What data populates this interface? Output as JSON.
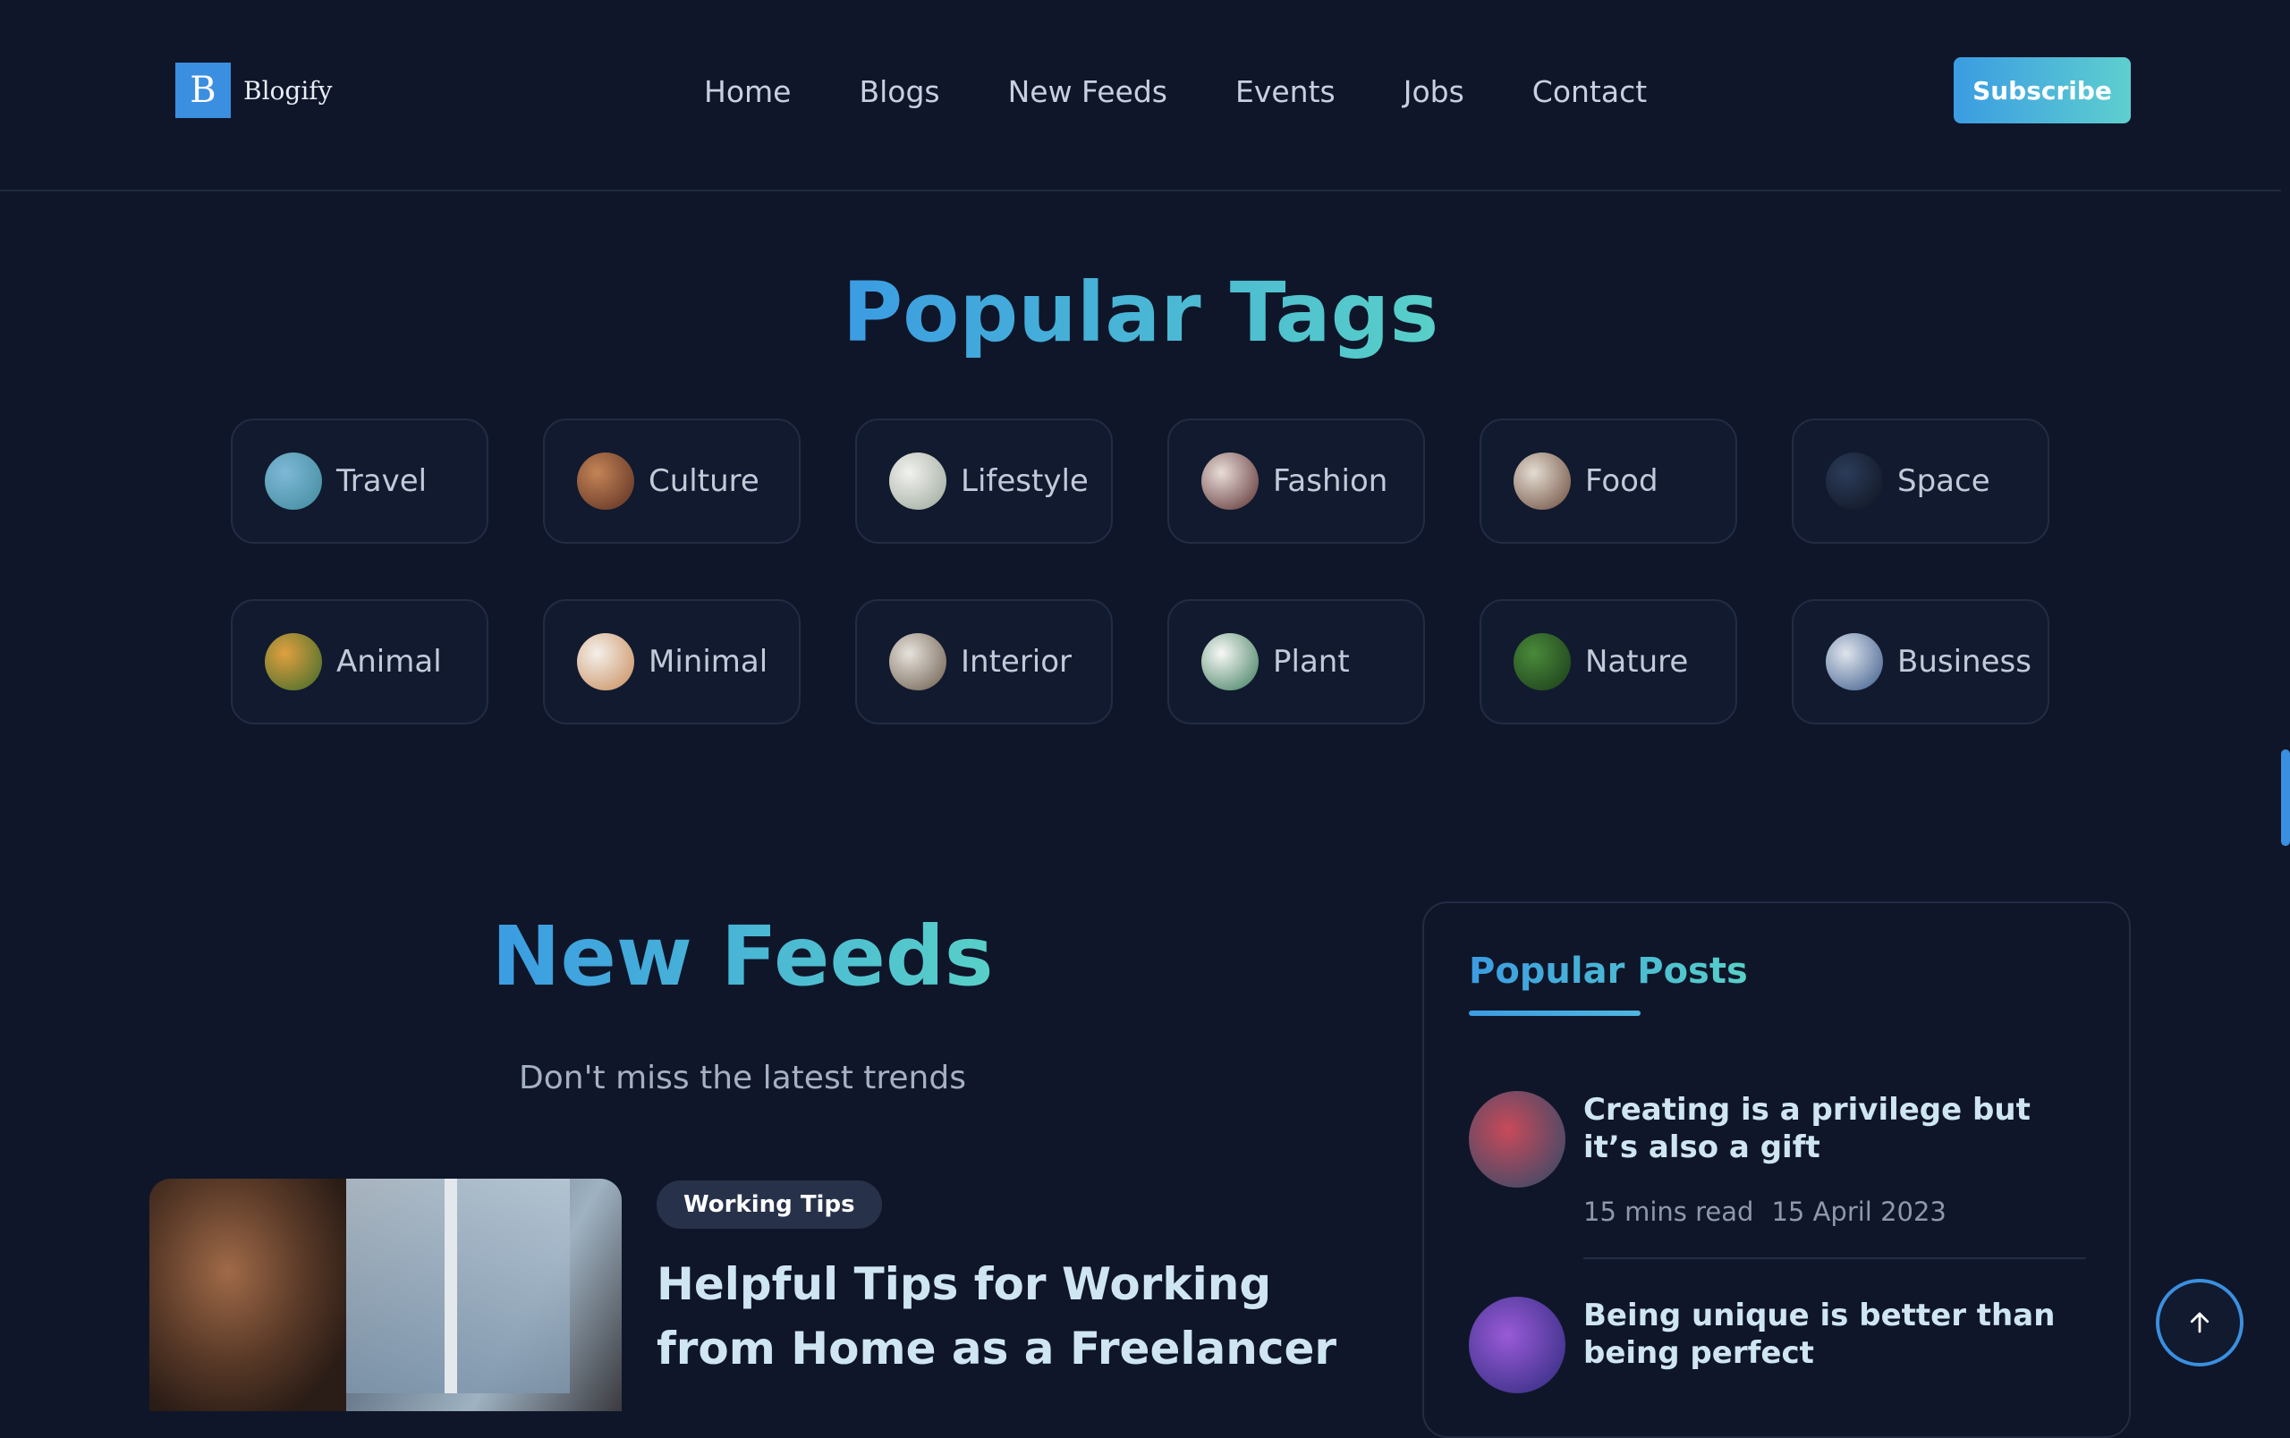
{
  "brand": {
    "logo_letter": "B",
    "name": "Blogify"
  },
  "nav": {
    "items": [
      "Home",
      "Blogs",
      "New Feeds",
      "Events",
      "Jobs",
      "Contact"
    ],
    "subscribe_label": "Subscribe"
  },
  "colors": {
    "background": "#0f1629",
    "accent_start": "#3b9ce2",
    "accent_end": "#58d0c8",
    "card_border": "#222c44"
  },
  "popular_tags": {
    "title": "Popular Tags",
    "tags": [
      {
        "label": "Travel",
        "thumb_colors": [
          "#7fb8d8",
          "#3f8a9a"
        ]
      },
      {
        "label": "Culture",
        "thumb_colors": [
          "#c48456",
          "#5a2e22"
        ]
      },
      {
        "label": "Lifestyle",
        "thumb_colors": [
          "#f2f2ee",
          "#9aa69a"
        ]
      },
      {
        "label": "Fashion",
        "thumb_colors": [
          "#e8ddd8",
          "#5a2e30"
        ]
      },
      {
        "label": "Food",
        "thumb_colors": [
          "#e4dcd2",
          "#6a4a3a"
        ]
      },
      {
        "label": "Space",
        "thumb_colors": [
          "#2c3c5a",
          "#0e1420"
        ]
      },
      {
        "label": "Animal",
        "thumb_colors": [
          "#e0a040",
          "#3a6a2a"
        ]
      },
      {
        "label": "Minimal",
        "thumb_colors": [
          "#f4f0ea",
          "#c88a5a"
        ]
      },
      {
        "label": "Interior",
        "thumb_colors": [
          "#e6e2dc",
          "#6a5a4a"
        ]
      },
      {
        "label": "Plant",
        "thumb_colors": [
          "#f8f8f6",
          "#3a7a5a"
        ]
      },
      {
        "label": "Nature",
        "thumb_colors": [
          "#4a8a3a",
          "#1a3a1a"
        ]
      },
      {
        "label": "Business",
        "thumb_colors": [
          "#dfe4ec",
          "#3a5a8a"
        ]
      }
    ]
  },
  "new_feeds": {
    "title": "New Feeds",
    "subtitle": "Don't miss the latest trends",
    "featured": {
      "category": "Working Tips",
      "title": "Helpful Tips for Working from Home as a Freelancer"
    }
  },
  "popular_posts": {
    "title": "Popular Posts",
    "posts": [
      {
        "title": "Creating is a privilege but it’s also a gift",
        "read_time": "15 mins read",
        "date": "15 April 2023",
        "thumb_colors": [
          "#c84a5a",
          "#2a4a6a"
        ]
      },
      {
        "title": "Being unique is better than being perfect",
        "thumb_colors": [
          "#9a5ad8",
          "#2a2a7a"
        ]
      }
    ]
  },
  "icons": {
    "to_top": "arrow-up-icon"
  }
}
